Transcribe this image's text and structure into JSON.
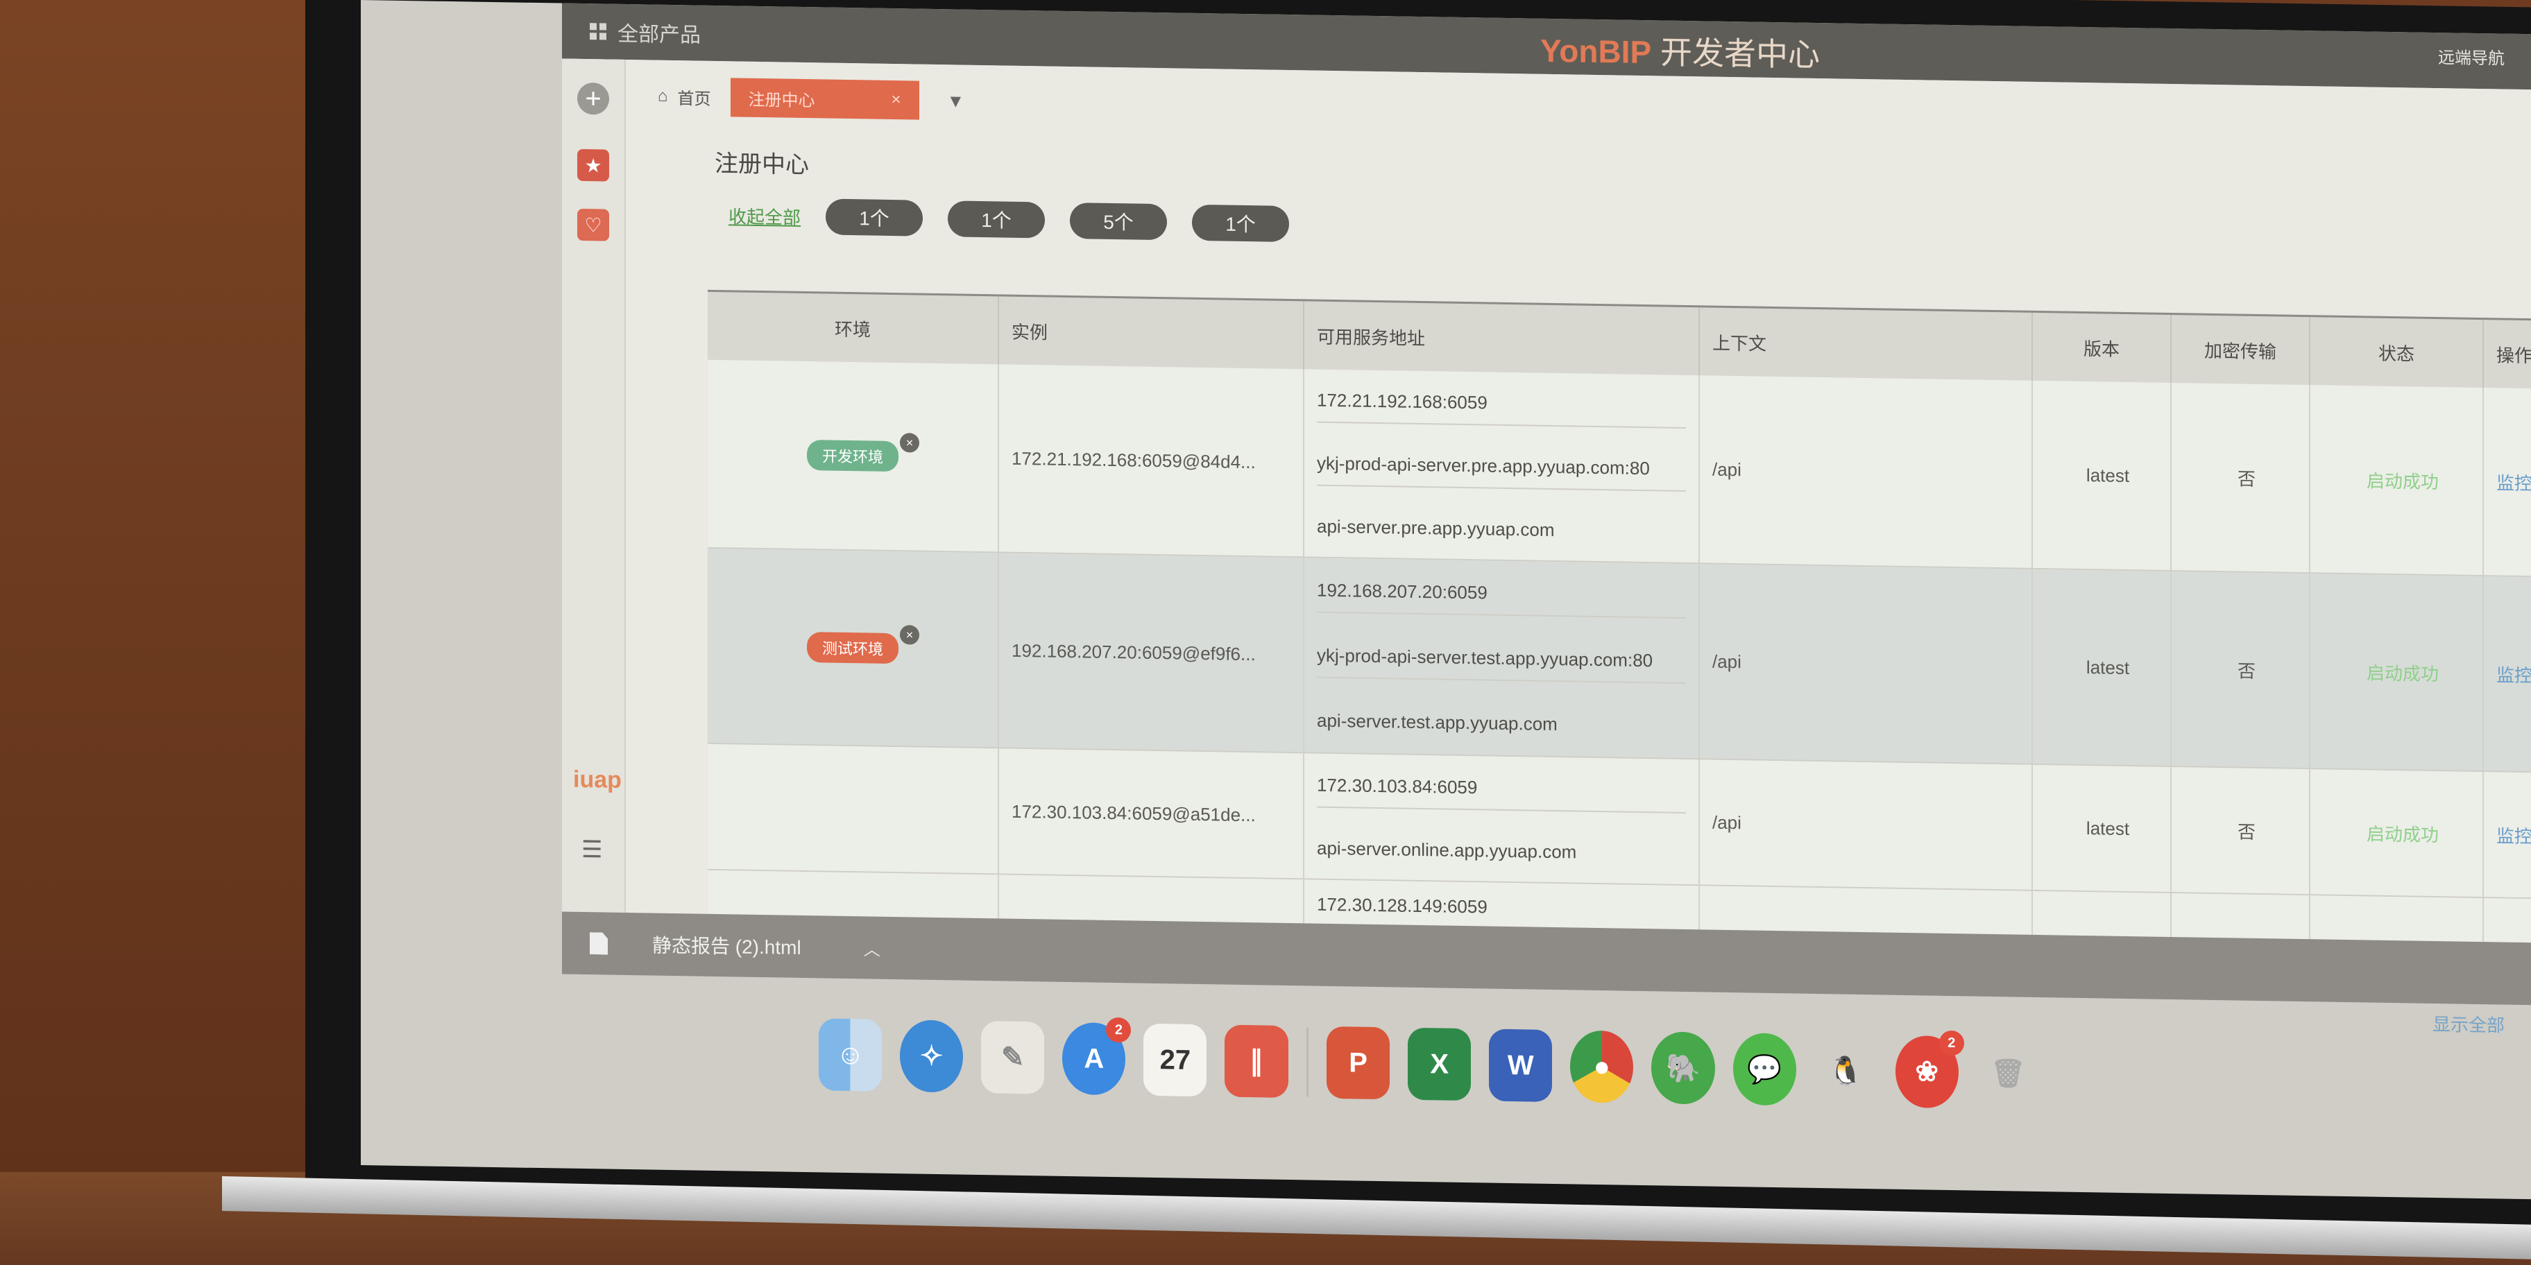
{
  "topbar": {
    "all_products": "全部产品",
    "brand_prefix": "YonBIP",
    "brand_suffix": "开发者中心",
    "right_text": "远端导航"
  },
  "tabs": {
    "home_label": "首页",
    "active_label": "注册中心"
  },
  "page": {
    "title": "注册中心",
    "filter_link": "收起全部",
    "pills": [
      "1个",
      "1个",
      "5个",
      "1个"
    ]
  },
  "table": {
    "headers": [
      "环境",
      "实例",
      "可用服务地址",
      "上下文",
      "版本",
      "加密传输",
      "状态",
      "操作"
    ],
    "rows": [
      {
        "env": "开发环境",
        "instance": "172.21.192.168:6059@84d4...",
        "addresses": [
          "172.21.192.168:6059",
          "ykj-prod-api-server.pre.app.yyuap.com:80",
          "api-server.pre.app.yyuap.com"
        ],
        "context": "/api",
        "version": "latest",
        "encrypt": "否",
        "status": "启动成功",
        "op": "监控"
      },
      {
        "env": "测试环境",
        "instance": "192.168.207.20:6059@ef9f6...",
        "addresses": [
          "192.168.207.20:6059",
          "ykj-prod-api-server.test.app.yyuap.com:80",
          "api-server.test.app.yyuap.com"
        ],
        "context": "/api",
        "version": "latest",
        "encrypt": "否",
        "status": "启动成功",
        "op": "监控"
      },
      {
        "env": "",
        "instance": "172.30.103.84:6059@a51de...",
        "addresses": [
          "172.30.103.84:6059",
          "api-server.online.app.yyuap.com"
        ],
        "context": "/api",
        "version": "latest",
        "encrypt": "否",
        "status": "启动成功",
        "op": "监控"
      },
      {
        "env": "",
        "instance": "",
        "addresses": [
          "172.30.128.149:6059"
        ],
        "context": "",
        "version": "",
        "encrypt": "",
        "status": "",
        "op": ""
      }
    ]
  },
  "download_bar": {
    "file_name": "静态报告 (2).html",
    "show_all": "显示全部"
  },
  "dock": {
    "calendar_day": "27",
    "appstore_badge": "2",
    "last_badge": "2",
    "items": [
      "finder-icon",
      "safari-icon",
      "notes-icon",
      "appstore-icon",
      "calendar-icon",
      "dingtalk-icon",
      "powerpoint-icon",
      "excel-icon",
      "word-icon",
      "chrome-icon",
      "evernote-icon",
      "wechat-icon",
      "qq-icon",
      "netease-icon",
      "trash-icon"
    ]
  }
}
